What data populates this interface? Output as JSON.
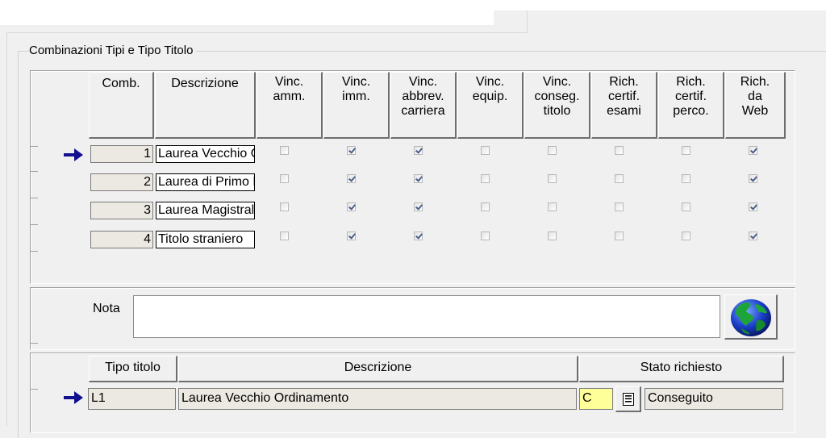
{
  "group_title": "Combinazioni Tipi e Tipo Titolo",
  "comb_table": {
    "headers": [
      "Comb.",
      "Descrizione",
      "Vinc.\namm.",
      "Vinc.\nimm.",
      "Vinc.\nabbrev.\ncarriera",
      "Vinc.\nequip.",
      "Vinc.\nconseg.\ntitolo",
      "Rich.\ncertif.\nesami",
      "Rich.\ncertif.\nperco.",
      "Rich.\nda\nWeb"
    ],
    "rows": [
      {
        "comb": "1",
        "descrizione": "Laurea Vecchio Ordinamento",
        "flags": [
          false,
          true,
          true,
          false,
          false,
          false,
          false,
          true
        ]
      },
      {
        "comb": "2",
        "descrizione": "Laurea di Primo Livello",
        "flags": [
          false,
          true,
          true,
          false,
          false,
          false,
          false,
          true
        ]
      },
      {
        "comb": "3",
        "descrizione": "Laurea Magistrale",
        "flags": [
          false,
          true,
          true,
          false,
          false,
          false,
          false,
          true
        ]
      },
      {
        "comb": "4",
        "descrizione": "Titolo straniero",
        "flags": [
          false,
          true,
          true,
          false,
          false,
          false,
          false,
          true
        ]
      }
    ],
    "current_row": 0
  },
  "nota": {
    "label": "Nota",
    "value": ""
  },
  "tipo_table": {
    "headers": [
      "Tipo titolo",
      "Descrizione",
      "Stato richiesto"
    ],
    "row": {
      "tipo": "L1",
      "descrizione": "Laurea Vecchio Ordinamento",
      "stato_code": "C",
      "stato_desc": "Conseguito"
    }
  },
  "icons": {
    "row_pointer": "arrow-right-icon",
    "globe": "globe-icon",
    "lookup": "lookup-list-icon"
  },
  "colors": {
    "pointer": "#101090",
    "stato_code_bg": "#ffff99",
    "readonly_bg": "#ece9e2"
  }
}
